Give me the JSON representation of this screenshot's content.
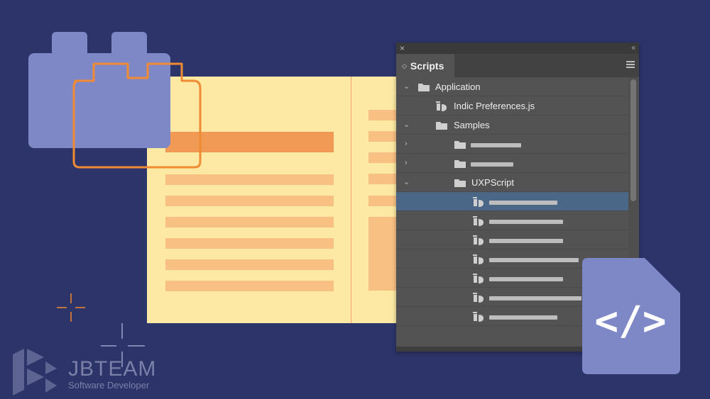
{
  "panel": {
    "close_symbol": "×",
    "collapse_symbol": "‹‹",
    "tab_label": "Scripts",
    "tab_arrows": "◇",
    "tree": {
      "application": "Application",
      "indic_preferences": "Indic Preferences.js",
      "samples": "Samples",
      "uxpscript": "UXPScript"
    },
    "selected_row": "uxp-script-item-1"
  },
  "code_icon_text": "</>",
  "logo": {
    "name": "JBTEAM",
    "tagline": "Software Developer"
  },
  "colors": {
    "background": "#2d3469",
    "panel": "#535353",
    "selection": "#4b6787",
    "accent_orange": "#f09a55",
    "page": "#fde9a3",
    "block": "#7e88c7"
  }
}
